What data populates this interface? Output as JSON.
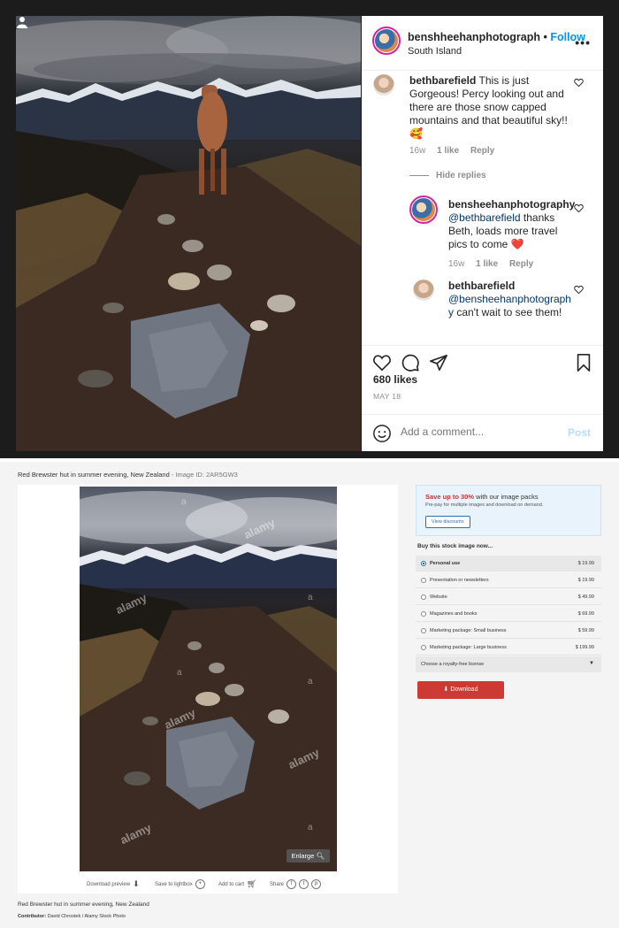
{
  "instagram": {
    "username": "benshheehanphotograph",
    "follow": "Follow",
    "location": "South Island",
    "more": "•••",
    "comments": [
      {
        "user": "bethbarefield",
        "text": "This is just Gorgeous! Percy looking out and there are those snow capped mountains and that beautiful sky!!🥰",
        "time": "16w",
        "likes": "1 like",
        "reply": "Reply"
      }
    ],
    "hide_replies": "Hide replies",
    "replies": [
      {
        "user": "bensheehanphotography",
        "mention": "@bethbarefield",
        "text": " thanks Beth, loads more travel pics to come ❤️",
        "time": "16w",
        "likes": "1 like",
        "reply": "Reply"
      },
      {
        "user": "bethbarefield",
        "mention": "@bensheehanphotography",
        "text": " can't wait to see them!"
      }
    ],
    "likes": "680 likes",
    "date": "MAY 18",
    "add_comment_placeholder": "Add a comment...",
    "post_button": "Post"
  },
  "alamy": {
    "caption_top": "Red Brewster hut in summer evening, New Zealand",
    "image_id": " - Image ID: 2AR5GW3",
    "watermark": "alamy",
    "watermark_small": "a",
    "enlarge": "Enlarge",
    "toolbar": {
      "download_preview": "Download preview",
      "save_lightbox": "Save to lightbox",
      "add_cart": "Add to cart",
      "share": "Share"
    },
    "caption_bottom": "Red Brewster hut in summer evening, New Zealand",
    "contributor_label": "Contributor:",
    "contributor": " David Chrostek / Alamy Stock Photo",
    "promo": {
      "highlight": "Save up to 30%",
      "title_rest": " with our image packs",
      "sub": "Pre-pay for multiple images and download on demand.",
      "button": "View discounts"
    },
    "buy_title": "Buy this stock image now...",
    "licenses": [
      {
        "label": "Personal use",
        "price": "$ 19.99",
        "selected": true
      },
      {
        "label": "Presentation or newsletters",
        "price": "$ 19.99",
        "selected": false
      },
      {
        "label": "Website",
        "price": "$ 49.99",
        "selected": false
      },
      {
        "label": "Magazines and books",
        "price": "$ 69.99",
        "selected": false
      },
      {
        "label": "Marketing package: Small business",
        "price": "$ 59.99",
        "selected": false
      },
      {
        "label": "Marketing package: Large business",
        "price": "$ 199.99",
        "selected": false
      }
    ],
    "royalty_free": "Choose a royalty-free license",
    "download": "⬇ Download"
  },
  "colors": {
    "instagram_link": "#0095f6",
    "alamy_red": "#cc3a33",
    "alamy_blue": "#2a6fb0"
  }
}
